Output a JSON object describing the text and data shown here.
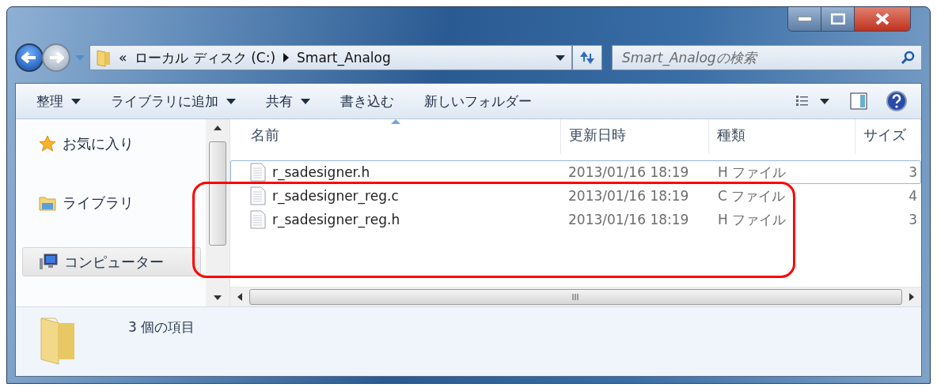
{
  "address": {
    "overflow": "«",
    "path": [
      "ローカル ディスク (C:)",
      "Smart_Analog"
    ]
  },
  "search": {
    "placeholder": "Smart_Analogの検索"
  },
  "toolbar": {
    "buttons": [
      {
        "label": "整理",
        "dropdown": true
      },
      {
        "label": "ライブラリに追加",
        "dropdown": true
      },
      {
        "label": "共有",
        "dropdown": true
      },
      {
        "label": "書き込む",
        "dropdown": false
      },
      {
        "label": "新しいフォルダー",
        "dropdown": false
      }
    ]
  },
  "sidebar": {
    "items": [
      {
        "label": "お気に入り",
        "kind": "favorites",
        "selected": false
      },
      {
        "label": "ライブラリ",
        "kind": "libraries",
        "selected": false
      },
      {
        "label": "コンピューター",
        "kind": "computer",
        "selected": true
      }
    ]
  },
  "table": {
    "columns": [
      {
        "label": "名前",
        "sorted": true
      },
      {
        "label": "更新日時",
        "sorted": false
      },
      {
        "label": "種類",
        "sorted": false
      },
      {
        "label": "サイズ",
        "sorted": false
      }
    ],
    "rows": [
      {
        "name": "r_sadesigner.h",
        "date": "2013/01/16 18:19",
        "type": "H ファイル",
        "size": "3",
        "focused": true
      },
      {
        "name": "r_sadesigner_reg.c",
        "date": "2013/01/16 18:19",
        "type": "C ファイル",
        "size": "4",
        "focused": false
      },
      {
        "name": "r_sadesigner_reg.h",
        "date": "2013/01/16 18:19",
        "type": "H ファイル",
        "size": "3",
        "focused": false
      }
    ]
  },
  "status_bar": {
    "text": "3 個の項目"
  }
}
